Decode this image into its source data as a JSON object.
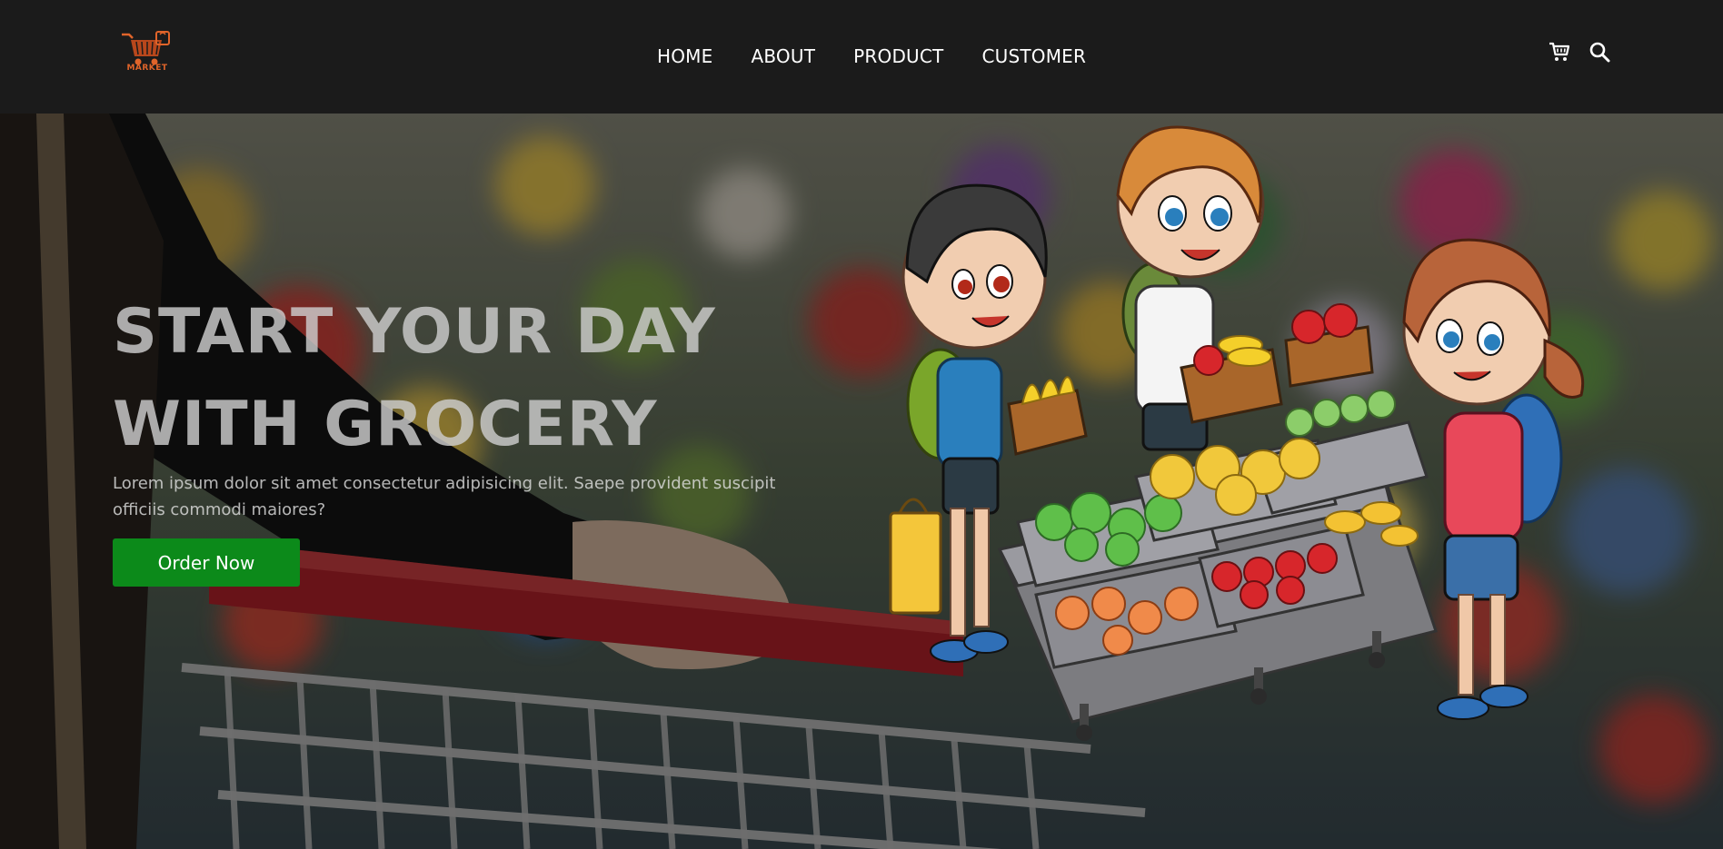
{
  "brand": {
    "logo_text": "MARKET",
    "logo_icon": "shopping-cart-logo",
    "accent_color": "#e0642a"
  },
  "nav": {
    "items": [
      {
        "label": "HOME"
      },
      {
        "label": "ABOUT"
      },
      {
        "label": "PRODUCT"
      },
      {
        "label": "CUSTOMER"
      }
    ],
    "icons": [
      "cart-icon",
      "search-icon"
    ]
  },
  "hero": {
    "title_line1": "START YOUR DAY",
    "title_line2": "WITH GROCERY",
    "description": "Lorem ipsum dolor sit amet consectetur adipisicing elit. Saepe provident suscipit officiis commodi maiores?",
    "cta_label": "Order Now",
    "cta_color": "#0c8a1a",
    "background": "blurred supermarket aisle with shopping cart",
    "illustration": "cartoon children at produce stand"
  }
}
